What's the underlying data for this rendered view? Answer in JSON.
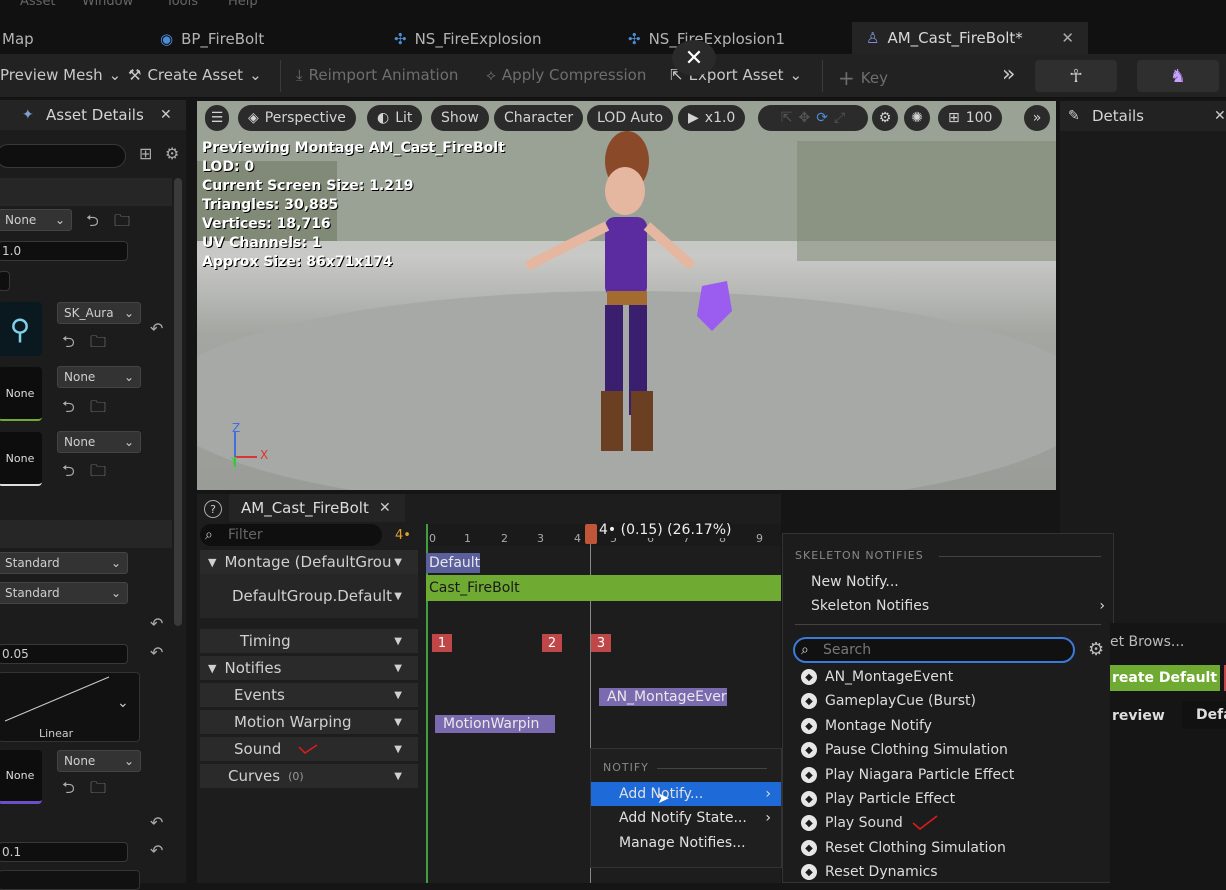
{
  "menu": [
    "Asset",
    "Window",
    "Tools",
    "Help"
  ],
  "tabs": [
    {
      "label": "Map"
    },
    {
      "label": "BP_FireBolt"
    },
    {
      "label": "NS_FireExplosion"
    },
    {
      "label": "NS_FireExplosion1"
    },
    {
      "label": "AM_Cast_FireBolt*"
    }
  ],
  "toolbar": {
    "preview_mesh": "Preview Mesh",
    "create_asset": "Create Asset",
    "reimport": "Reimport Animation",
    "apply_compression": "Apply Compression",
    "export_asset": "Export Asset",
    "key": "Key"
  },
  "left_panel": {
    "title": "Asset Details",
    "fields": {
      "none1": "None",
      "rate": "1.0",
      "mesh": "SK_Aura",
      "none2": "None",
      "none3": "None",
      "thumb_none1": "None",
      "thumb_none2": "None",
      "blend1": "Standard",
      "blend2": "Standard",
      "blend_time": "0.05",
      "curve_label": "Linear",
      "thumb_none3": "None",
      "none4": "None",
      "val_bottom": "0.1"
    }
  },
  "viewport": {
    "perspective": "Perspective",
    "lit": "Lit",
    "show": "Show",
    "character": "Character",
    "lod": "LOD Auto",
    "speed": "x1.0",
    "grid": "100",
    "stats": [
      "Previewing Montage AM_Cast_FireBolt",
      "LOD: 0",
      "Current Screen Size: 1.219",
      "Triangles: 30,885",
      "Vertices: 18,716",
      "UV Channels: 1",
      "Approx Size: 86x71x174"
    ],
    "axis_z": "Z",
    "axis_x": "X",
    "axis_y": "Y"
  },
  "details": {
    "title": "Details"
  },
  "timeline": {
    "tab": "AM_Cast_FireBolt",
    "filter_placeholder": "Filter",
    "count": "4•",
    "playhead": "4• (0.15) (26.17%)",
    "ticks": [
      "0",
      "1",
      "2",
      "3",
      "4",
      "5",
      "6",
      "7",
      "8",
      "9"
    ],
    "rows": [
      {
        "label": "Montage (DefaultGrou"
      },
      {
        "label": "DefaultGroup.Default"
      },
      {
        "label": "Timing"
      },
      {
        "label": "Notifies"
      },
      {
        "label": "Events"
      },
      {
        "label": "Motion Warping"
      },
      {
        "label": "Sound"
      },
      {
        "label": "Curves"
      }
    ],
    "curves_count": "(0)",
    "default_section": "Default",
    "segment": "Cast_FireBolt",
    "markers": [
      "1",
      "2",
      "3"
    ],
    "notify_event": "AN_MontageEver",
    "notify_warp": "MotionWarpin"
  },
  "context_menu": {
    "header": "NOTIFY",
    "items": [
      "Add Notify...",
      "Add Notify State...",
      "Manage Notifies..."
    ]
  },
  "submenu": {
    "header": "SKELETON NOTIFIES",
    "new_notify": "New Notify...",
    "skeleton_notifies": "Skeleton Notifies",
    "search_placeholder": "Search",
    "items": [
      "AN_MontageEvent",
      "GameplayCue (Burst)",
      "Montage Notify",
      "Pause Clothing Simulation",
      "Play Niagara Particle Effect",
      "Play Particle Effect",
      "Play Sound",
      "Reset Clothing Simulation",
      "Reset Dynamics"
    ]
  },
  "far_right": {
    "asset_browser": "et Brows...",
    "create_default": "reate Default",
    "preview": "review",
    "default": "Defa"
  },
  "colors": {
    "accent": "#1e6ad9",
    "segment": "#6faa32",
    "marker": "#c04747",
    "notify": "#6b6ba6"
  }
}
